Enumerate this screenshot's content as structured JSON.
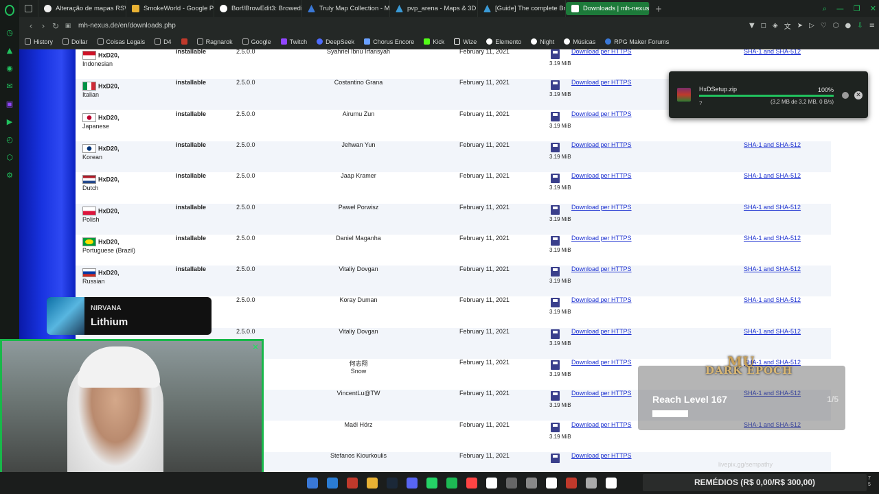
{
  "tabs": [
    {
      "label": "",
      "icon": "tab-grid-icon",
      "color": "#9aa09c"
    },
    {
      "label": "Alteração de mapas RSW",
      "color": "#f0f0f0"
    },
    {
      "label": "SmokeWorld - Google Pla",
      "color": "#e9b234"
    },
    {
      "label": "Borf/BrowEdit3: Browedit",
      "color": "#ffffff"
    },
    {
      "label": "Truly Map Collection - Ma",
      "color": "#3a78d6"
    },
    {
      "label": "pvp_arena - Maps & 3D R",
      "color": "#3a9ad6"
    },
    {
      "label": "[Guide] The complete Bro",
      "color": "#3a9ad6"
    },
    {
      "label": "Downloads | mh-nexus",
      "color": "#21c25e",
      "active": true
    }
  ],
  "address": {
    "url": "mh-nexus.de/en/downloads.php"
  },
  "bookmarks": [
    {
      "label": "History",
      "color": "#aaaaaa"
    },
    {
      "label": "Dollar",
      "color": "#aaaaaa"
    },
    {
      "label": "Coisas Legais",
      "color": "#aaaaaa"
    },
    {
      "label": "D4",
      "color": "#aaaaaa"
    },
    {
      "label": "",
      "color": "#c0392b"
    },
    {
      "label": "Ragnarok",
      "color": "#aaaaaa"
    },
    {
      "label": "Google",
      "color": "#aaaaaa"
    },
    {
      "label": "Twitch",
      "color": "#9146ff"
    },
    {
      "label": "DeepSeek",
      "color": "#4d6bfe"
    },
    {
      "label": "Chorus Encore",
      "color": "#6aa0ff"
    },
    {
      "label": "Kick",
      "color": "#53fc18"
    },
    {
      "label": "Wize",
      "color": "#ffffff"
    },
    {
      "label": "Elemento",
      "color": "#ffffff"
    },
    {
      "label": "Night",
      "color": "#ffffff"
    },
    {
      "label": "Músicas",
      "color": "#ffffff"
    },
    {
      "label": "RPG Maker Forums",
      "color": "#3a78d6"
    }
  ],
  "downloads_table": {
    "rows": [
      {
        "product": "HxD20,",
        "language": "Indonesian",
        "flag": [
          "#ce1126",
          "#ffffff"
        ],
        "status": "installable",
        "version": "2.5.0.0",
        "translator": "Syahriel Ibnu Irfansyah",
        "date": "February 11, 2021",
        "size": "3.19 MiB",
        "download": "Download per HTTPS",
        "sha": "SHA-1 and SHA-512"
      },
      {
        "product": "HxD20,",
        "language": "Italian",
        "flag": [
          "#009246",
          "#ffffff",
          "#ce2b37"
        ],
        "status": "installable",
        "version": "2.5.0.0",
        "translator": "Costantino Grana",
        "date": "February 11, 2021",
        "size": "3.19 MiB",
        "download": "Download per HTTPS",
        "sha": ""
      },
      {
        "product": "HxD20,",
        "language": "Japanese",
        "flag": [
          "#ffffff",
          "#bc002d"
        ],
        "status": "installable",
        "version": "2.5.0.0",
        "translator": "Airumu Zun",
        "date": "February 11, 2021",
        "size": "3.19 MiB",
        "download": "Download per HTTPS",
        "sha": ""
      },
      {
        "product": "HxD20,",
        "language": "Korean",
        "flag": [
          "#ffffff",
          "#003478"
        ],
        "status": "installable",
        "version": "2.5.0.0",
        "translator": "Jehwan Yun",
        "date": "February 11, 2021",
        "size": "3.19 MiB",
        "download": "Download per HTTPS",
        "sha": "SHA-1 and SHA-512"
      },
      {
        "product": "HxD20,",
        "language": "Dutch",
        "flag": [
          "#ae1c28",
          "#ffffff",
          "#21468b"
        ],
        "status": "installable",
        "version": "2.5.0.0",
        "translator": "Jaap Kramer",
        "date": "February 11, 2021",
        "size": "3.19 MiB",
        "download": "Download per HTTPS",
        "sha": "SHA-1 and SHA-512"
      },
      {
        "product": "HxD20,",
        "language": "Polish",
        "flag": [
          "#ffffff",
          "#dc143c"
        ],
        "status": "installable",
        "version": "2.5.0.0",
        "translator": "Paweł Porwisz",
        "date": "February 11, 2021",
        "size": "3.19 MiB",
        "download": "Download per HTTPS",
        "sha": "SHA-1 and SHA-512"
      },
      {
        "product": "HxD20,",
        "language": "Portuguese (Brazil)",
        "flag": [
          "#009c3b",
          "#ffdf00"
        ],
        "status": "installable",
        "version": "2.5.0.0",
        "translator": "Daniel Maganha",
        "date": "February 11, 2021",
        "size": "3.19 MiB",
        "download": "Download per HTTPS",
        "sha": "SHA-1 and SHA-512"
      },
      {
        "product": "HxD20,",
        "language": "Russian",
        "flag": [
          "#ffffff",
          "#0039a6",
          "#d52b1e"
        ],
        "status": "installable",
        "version": "2.5.0.0",
        "translator": "Vitaliy Dovgan",
        "date": "February 11, 2021",
        "size": "3.19 MiB",
        "download": "Download per HTTPS",
        "sha": "SHA-1 and SHA-512"
      },
      {
        "product": "",
        "language": "",
        "flag": [],
        "status": "",
        "version": "2.5.0.0",
        "translator": "Koray Duman",
        "date": "February 11, 2021",
        "size": "3.19 MiB",
        "download": "Download per HTTPS",
        "sha": "SHA-1 and SHA-512"
      },
      {
        "product": "",
        "language": "",
        "flag": [],
        "status": "",
        "version": "2.5.0.0",
        "translator": "Vitaliy Dovgan",
        "date": "February 11, 2021",
        "size": "3.19 MiB",
        "download": "Download per HTTPS",
        "sha": "SHA-1 and SHA-512"
      },
      {
        "product": "",
        "language": "",
        "flag": [],
        "status": "",
        "version": "",
        "translator": "何志翔\nSnow",
        "date": "February 11, 2021",
        "size": "3.19 MiB",
        "download": "Download per HTTPS",
        "sha": "SHA-1 and SHA-512"
      },
      {
        "product": "",
        "language": "",
        "flag": [],
        "status": "",
        "version": "",
        "translator": "VincentLu@TW",
        "date": "February 11, 2021",
        "size": "3.19 MiB",
        "download": "Download per HTTPS",
        "sha": "SHA-1 and SHA-512"
      },
      {
        "product": "",
        "language": "",
        "flag": [],
        "status": "",
        "version": "",
        "translator": "Maël Hörz",
        "date": "February 11, 2021",
        "size": "3.19 MiB",
        "download": "Download per HTTPS",
        "sha": "SHA-1 and SHA-512"
      },
      {
        "product": "",
        "language": "",
        "flag": [],
        "status": "",
        "version": "",
        "translator": "Stefanos Kiourkoulis",
        "date": "February 11, 2021",
        "size": "",
        "download": "Download per HTTPS",
        "sha": ""
      }
    ]
  },
  "download_popup": {
    "filename": "HxDSetup.zip",
    "percent": "100%",
    "progress": 1.0,
    "status_text": "(3,2 MB de 3,2 MB, 0 B/s)",
    "unknown": "?"
  },
  "music_overlay": {
    "artist": "NIRVANA",
    "song": "Lithium"
  },
  "game_overlay": {
    "logo_line1": "MU",
    "logo_line2": "DARK EPOCH",
    "objective": "Reach Level 167",
    "count": "1/5",
    "progress": 0.2
  },
  "watermark": "livepix.gg/sempathy",
  "remedios": "REMÉDIOS (R$ 0,00/R$ 300,00)",
  "clock": {
    "line1": "7",
    "line2": "5"
  },
  "taskbar_icons": [
    "#3a78d6",
    "#2b7cd3",
    "#c0392b",
    "#e9b234",
    "#1b2838",
    "#5865f2",
    "#25d366",
    "#1db954",
    "#ff4444",
    "#ffffff",
    "#666666",
    "#888888",
    "#ffffff",
    "#c0392b",
    "#aaaaaa",
    "#ffffff"
  ]
}
